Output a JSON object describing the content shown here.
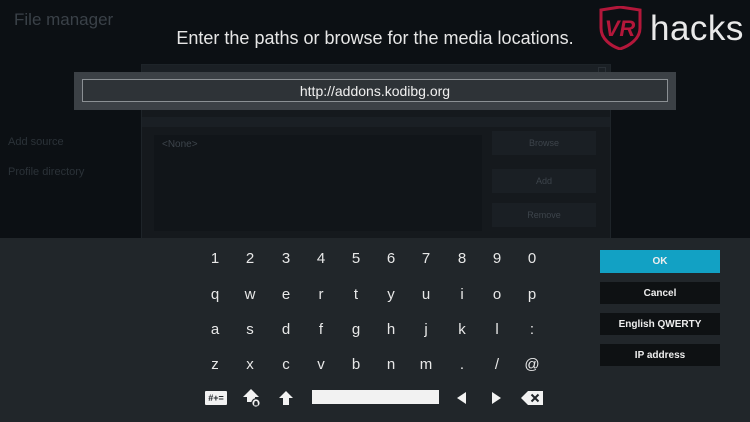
{
  "background": {
    "window_title": "File manager",
    "sidebar_items": [
      "Add source",
      "Profile directory"
    ],
    "empty_entry": "<None>",
    "buttons": [
      "Browse",
      "Add",
      "Remove"
    ]
  },
  "dialog": {
    "heading": "Enter the paths or browse for the media locations."
  },
  "input": {
    "value": "http://addons.kodibg.org"
  },
  "logo": {
    "mark": "VR",
    "text": "hacks",
    "accent": "#b3173a"
  },
  "keyboard": {
    "rows": [
      [
        "1",
        "2",
        "3",
        "4",
        "5",
        "6",
        "7",
        "8",
        "9",
        "0"
      ],
      [
        "q",
        "w",
        "e",
        "r",
        "t",
        "y",
        "u",
        "i",
        "o",
        "p"
      ],
      [
        "a",
        "s",
        "d",
        "f",
        "g",
        "h",
        "j",
        "k",
        "l",
        ":"
      ],
      [
        "z",
        "x",
        "c",
        "v",
        "b",
        "n",
        "m",
        ".",
        "/",
        "@"
      ]
    ],
    "function_keys": [
      {
        "name": "symbols-key",
        "label": "#+="
      },
      {
        "name": "caps-lock-key",
        "icon": "caps-lock-icon"
      },
      {
        "name": "shift-key",
        "icon": "shift-icon"
      },
      {
        "name": "space-key",
        "icon": "space-bar"
      },
      {
        "name": "cursor-left-key",
        "icon": "arrow-left-icon"
      },
      {
        "name": "cursor-right-key",
        "icon": "arrow-right-icon"
      },
      {
        "name": "backspace-key",
        "icon": "backspace-icon"
      }
    ]
  },
  "actions": {
    "ok": "OK",
    "cancel": "Cancel",
    "layout": "English QWERTY",
    "ip": "IP address"
  },
  "colors": {
    "accent": "#12a1c4",
    "panel": "#21262a",
    "input_bar": "#3c4146"
  }
}
